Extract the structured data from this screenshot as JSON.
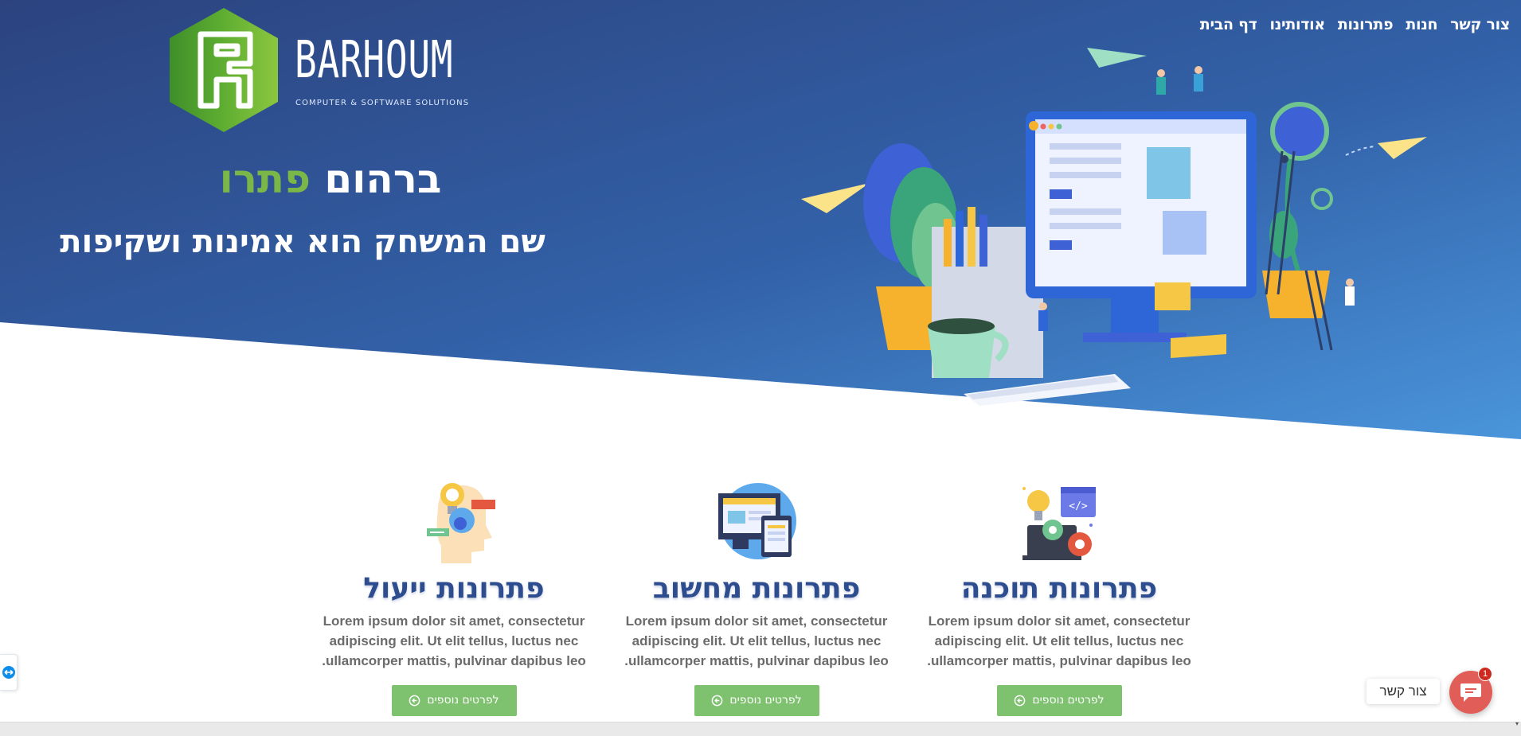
{
  "nav": {
    "items": [
      {
        "id": "home",
        "label": "דף הבית"
      },
      {
        "id": "about",
        "label": "אודותינו"
      },
      {
        "id": "solutions",
        "label": "פתרונות"
      },
      {
        "id": "shop",
        "label": "חנות"
      },
      {
        "id": "contact",
        "label": "צור קשר"
      }
    ]
  },
  "logo": {
    "wordmark": "BARHOUM",
    "tagline": "COMPUTER & SOFTWARE SOLUTIONS"
  },
  "hero": {
    "title_main": "ברהום",
    "title_accent": "פתרו",
    "subtitle": "שם המשחק הוא אמינות ושקיפות"
  },
  "services": [
    {
      "title": "פתרונות תוכנה",
      "text": "Lorem ipsum dolor sit amet, consectetur adipiscing elit. Ut elit tellus, luctus nec ullamcorper mattis, pulvinar dapibus leo.",
      "button": "לפרטים נוספים",
      "icon": "software-development-icon"
    },
    {
      "title": "פתרונות מחשוב",
      "text": "Lorem ipsum dolor sit amet, consectetur adipiscing elit. Ut elit tellus, luctus nec ullamcorper mattis, pulvinar dapibus leo.",
      "button": "לפרטים נוספים",
      "icon": "computer-devices-icon"
    },
    {
      "title": "פתרונות ייעול",
      "text": "Lorem ipsum dolor sit amet, consectetur adipiscing elit. Ut elit tellus, luctus nec ullamcorper mattis, pulvinar dapibus leo.",
      "button": "לפרטים נוספים",
      "icon": "consulting-idea-icon"
    }
  ],
  "chat": {
    "label": "צור קשר",
    "badge_count": "1"
  },
  "colors": {
    "hero_dark": "#2d4783",
    "hero_light": "#4a8fd6",
    "accent_green": "#7ab648",
    "service_title": "#2e4d8f",
    "button_green": "#7ec16e",
    "chat_red": "#e05e57"
  }
}
